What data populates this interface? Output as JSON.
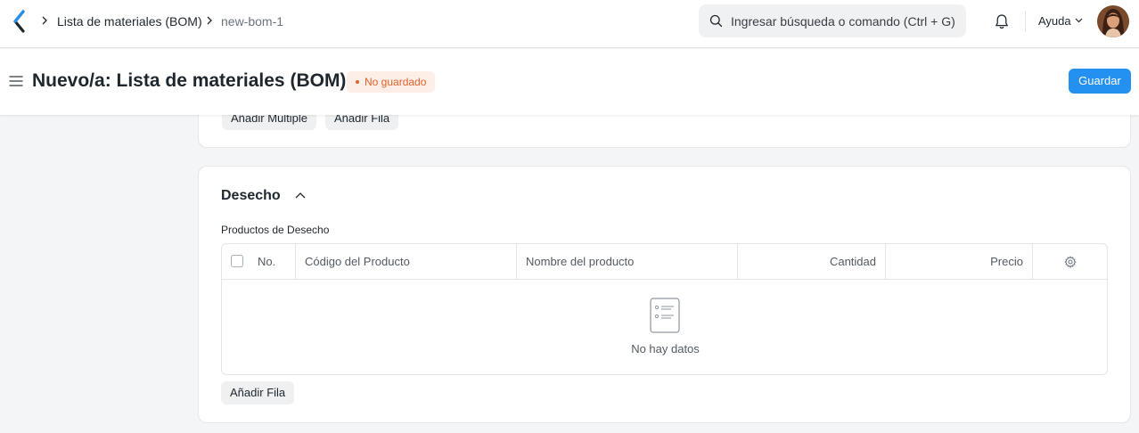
{
  "navbar": {
    "breadcrumbs": [
      "Lista de materiales (BOM)",
      "new-bom-1"
    ],
    "search_placeholder": "Ingresar búsqueda o comando (Ctrl + G)",
    "help_label": "Ayuda"
  },
  "page_head": {
    "title": "Nuevo/a: Lista de materiales (BOM)",
    "status": "No guardado",
    "save_label": "Guardar"
  },
  "top_card": {
    "add_multiple_label": "Añadir Múltiple",
    "add_row_label": "Añadir Fila"
  },
  "scrap_section": {
    "title": "Desecho",
    "field_label": "Productos de Desecho",
    "columns": [
      "No.",
      "Código del Producto",
      "Nombre del producto",
      "Cantidad",
      "Precio"
    ],
    "empty_text": "No hay datos",
    "add_row_label": "Añadir Fila"
  },
  "colors": {
    "primary": "#2490ef",
    "status_orange": "#e0622a",
    "background": "#f4f5f6"
  }
}
